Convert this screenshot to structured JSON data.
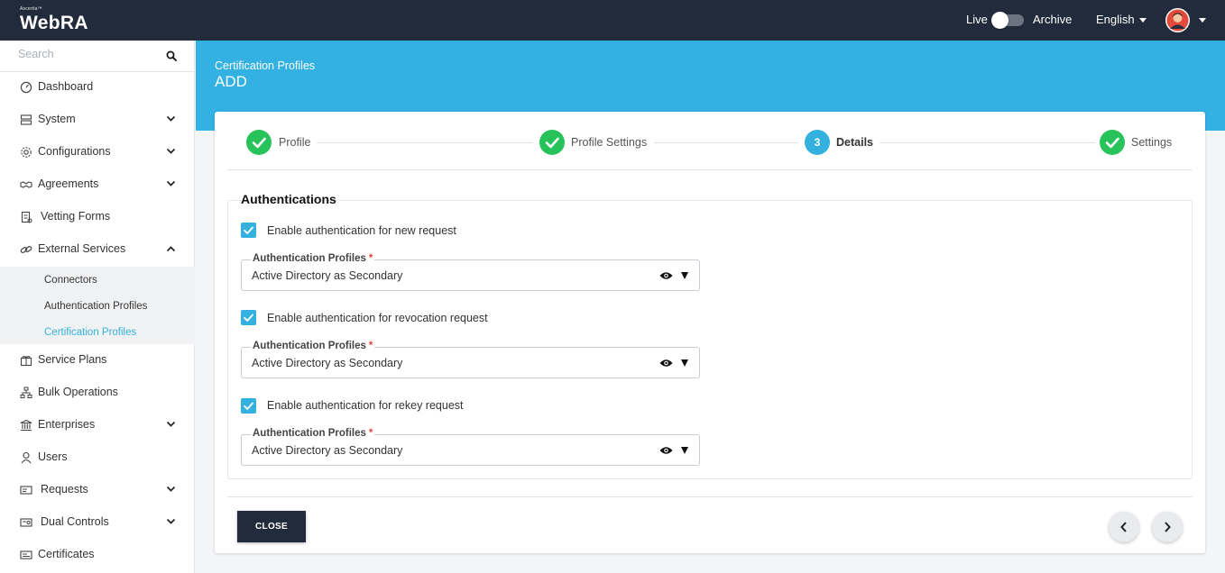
{
  "header": {
    "brand_small": "Ascertia™",
    "brand": "WebRA",
    "live_label": "Live",
    "archive_label": "Archive",
    "language": "English"
  },
  "sidebar": {
    "search_placeholder": "Search",
    "items": [
      {
        "label": "Dashboard",
        "icon": "dashboard-icon"
      },
      {
        "label": "System",
        "icon": "server-icon"
      },
      {
        "label": "Configurations",
        "icon": "gear-icon"
      },
      {
        "label": "Agreements",
        "icon": "handshake-icon"
      },
      {
        "label": "Vetting Forms",
        "icon": "form-icon"
      },
      {
        "label": "External Services",
        "icon": "link-icon"
      },
      {
        "label": "Service Plans",
        "icon": "gift-icon"
      },
      {
        "label": "Bulk Operations",
        "icon": "hierarchy-icon"
      },
      {
        "label": "Enterprises",
        "icon": "bank-icon"
      },
      {
        "label": "Users",
        "icon": "user-icon"
      },
      {
        "label": "Requests",
        "icon": "requests-icon"
      },
      {
        "label": "Dual Controls",
        "icon": "dual-control-icon"
      },
      {
        "label": "Certificates",
        "icon": "certificate-icon"
      }
    ],
    "sub_items": [
      {
        "label": "Connectors"
      },
      {
        "label": "Authentication Profiles"
      },
      {
        "label": "Certification Profiles"
      }
    ]
  },
  "page": {
    "breadcrumb": "Certification Profiles",
    "title": "ADD"
  },
  "stepper": {
    "steps": [
      {
        "label": "Profile",
        "state": "done"
      },
      {
        "label": "Profile Settings",
        "state": "done"
      },
      {
        "label": "Details",
        "state": "current",
        "number": "3"
      },
      {
        "label": "Settings",
        "state": "done"
      }
    ]
  },
  "auth": {
    "section_title": "Authentications",
    "rows": [
      {
        "checkbox_label": "Enable authentication for new request",
        "checked": true,
        "field_label": "Authentication Profiles",
        "required": "*",
        "value": "Active Directory as Secondary"
      },
      {
        "checkbox_label": "Enable authentication for revocation request",
        "checked": true,
        "field_label": "Authentication Profiles",
        "required": "*",
        "value": "Active Directory as Secondary"
      },
      {
        "checkbox_label": "Enable authentication for rekey request",
        "checked": true,
        "field_label": "Authentication Profiles",
        "required": "*",
        "value": "Active Directory as Secondary"
      }
    ]
  },
  "footer": {
    "close_label": "CLOSE"
  },
  "colors": {
    "topbar": "#222b3c",
    "accent": "#33b1e3",
    "success": "#27c35a"
  }
}
